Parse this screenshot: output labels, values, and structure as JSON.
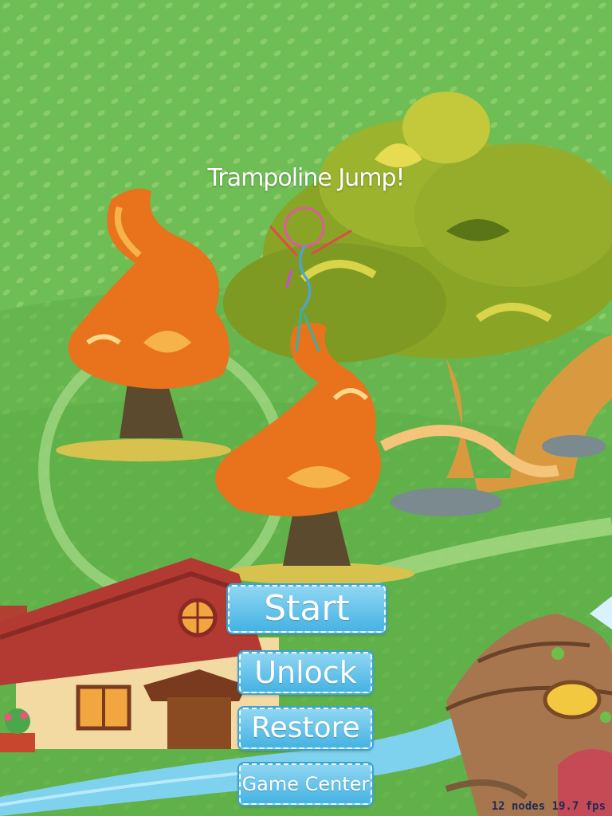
{
  "game": {
    "title": "Trampoline Jump!"
  },
  "menu": {
    "start_label": "Start",
    "unlock_label": "Unlock",
    "restore_label": "Restore",
    "game_center_label": "Game Center"
  },
  "debug": {
    "stats": "12 nodes 19.7 fps"
  },
  "colors": {
    "background_green": "#7cc25a",
    "button_blue": "#45b3e3",
    "orange_tree": "#e8731c",
    "olive_tree": "#8aa426"
  }
}
